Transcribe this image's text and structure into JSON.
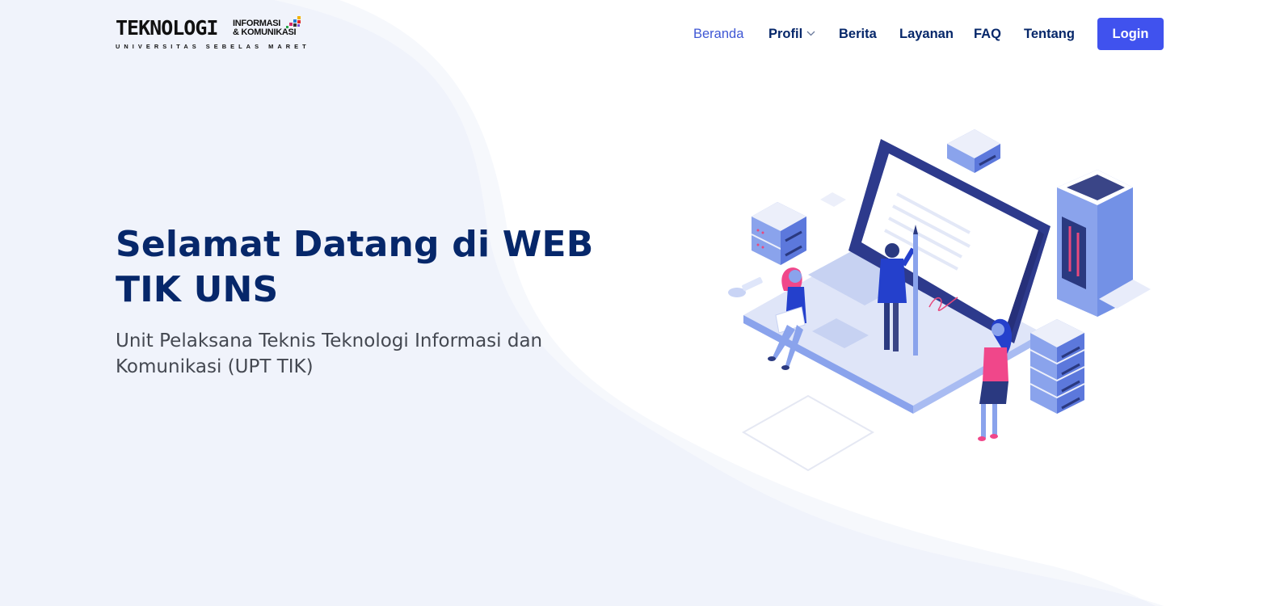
{
  "header": {
    "logo": {
      "main_text": "TEKNOLOGI",
      "secondary_line1": "INFORMASI",
      "secondary_line2": "& KOMUNIKASI",
      "subtitle": "UNIVERSITAS SEBELAS MARET"
    },
    "nav": [
      {
        "label": "Beranda",
        "active": true
      },
      {
        "label": "Profil",
        "dropdown": true
      },
      {
        "label": "Berita"
      },
      {
        "label": "Layanan"
      },
      {
        "label": "FAQ"
      },
      {
        "label": "Tentang"
      }
    ],
    "login_label": "Login"
  },
  "hero": {
    "title": "Selamat Datang di WEB TIK UNS",
    "subtitle": "Unit Pelaksana Teknis Teknologi Informasi dan Komunikasi (UPT TIK)"
  },
  "illustration": {
    "icon": "laptop-servers-people-illustration"
  },
  "colors": {
    "primary": "#4052ee",
    "heading": "#06276a",
    "nav_active": "#3f57d4",
    "background_wave": "#f0f3fb"
  }
}
